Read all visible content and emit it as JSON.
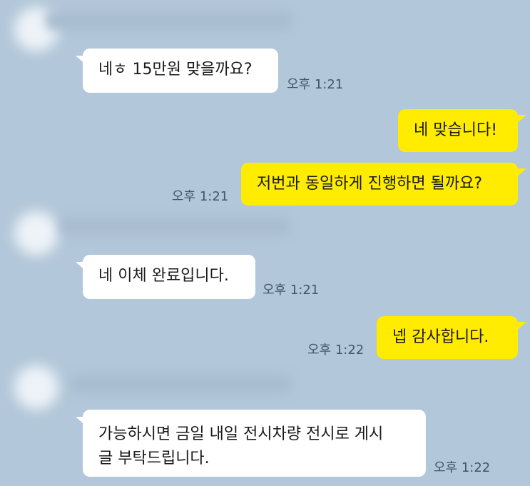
{
  "messages": [
    {
      "direction": "received",
      "text": "네ㅎ 15만원 맞을까요?",
      "time": "오후 1:21"
    },
    {
      "direction": "sent",
      "text": "네 맞습니다!",
      "time": ""
    },
    {
      "direction": "sent",
      "text": "저번과 동일하게 진행하면 될까요?",
      "time": "오후 1:21"
    },
    {
      "direction": "received",
      "text": "네 이체 완료입니다.",
      "time": "오후 1:21"
    },
    {
      "direction": "sent",
      "text": "넵 감사합니다.",
      "time": "오후 1:22"
    },
    {
      "direction": "received",
      "text_lines": [
        "가능하시면 금일 내일 전시차량 전시로 게시",
        "글 부탁드립니다."
      ],
      "time": "오후 1:22"
    }
  ],
  "colors": {
    "background": "#b2c7d9",
    "received_bubble": "#ffffff",
    "sent_bubble": "#ffec00",
    "time_text": "#42566a"
  }
}
